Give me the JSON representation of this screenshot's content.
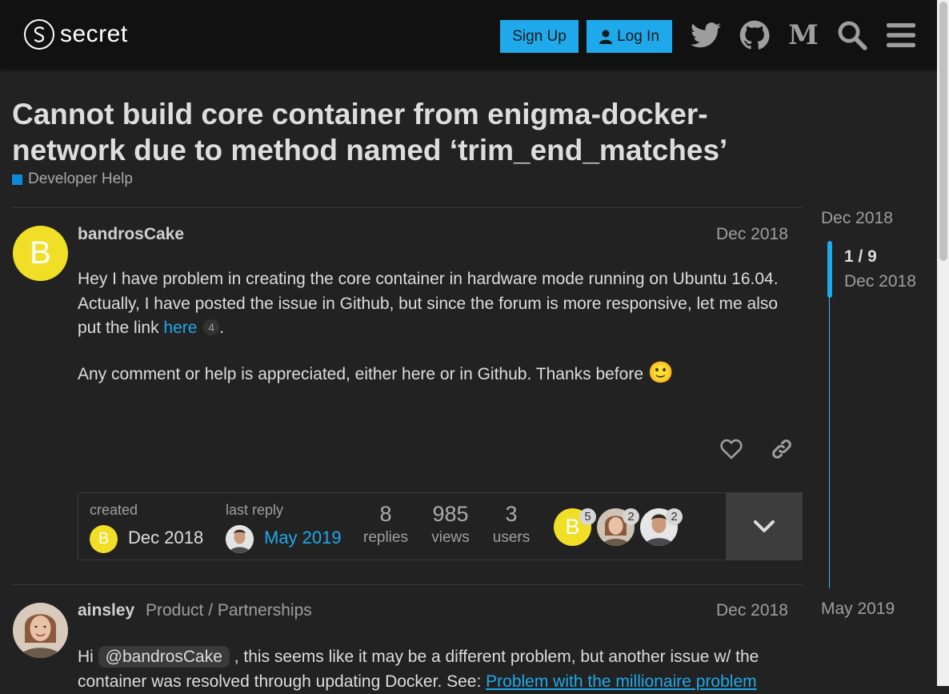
{
  "header": {
    "logo_text": "secret",
    "signup_label": "Sign Up",
    "login_label": "Log In",
    "icons": [
      "twitter-icon",
      "github-icon",
      "medium-icon",
      "search-icon",
      "hamburger-menu-icon"
    ]
  },
  "topic": {
    "title": "Cannot build core container from enigma-docker-network due to method named ‘trim_end_matches’",
    "category": "Developer Help",
    "category_color": "#0b8ad8"
  },
  "post1": {
    "avatar_letter": "B",
    "avatar_color": "#f0de27",
    "username": "bandrosCake",
    "date": "Dec 2018",
    "para1_text": "Hey I have problem in creating the core container in hardware mode running on Ubuntu 16.04. Actually, I have posted the issue in Github, but since the forum is more responsive, let me also put the link ",
    "link_text": "here",
    "link_clicks": "4",
    "para1_end": ".",
    "para2_text": "Any comment or help is appreciated, either here or in Github. Thanks before",
    "emoji": "🙂"
  },
  "topic_map": {
    "created_label": "created",
    "created_date": "Dec 2018",
    "last_reply_label": "last reply",
    "last_reply_date": "May 2019",
    "replies": "8",
    "replies_label": "replies",
    "views": "985",
    "views_label": "views",
    "users": "3",
    "users_label": "users",
    "participants": [
      {
        "letter": "B",
        "count": "5"
      },
      {
        "count": "2"
      },
      {
        "count": "2"
      }
    ]
  },
  "post2": {
    "username": "ainsley",
    "user_title": "Product / Partnerships",
    "date": "Dec 2018",
    "text_hi": "Hi ",
    "mention": "@bandrosCake",
    "text_rest": " , this seems like it may be a different problem, but another issue w/ the",
    "text_line2": "container was resolved through updating Docker. See: ",
    "link_text": "Problem with the millionaire problem"
  },
  "timeline": {
    "start_date": "Dec 2018",
    "position": "1 / 9",
    "position_date": "Dec 2018",
    "end_date": "May 2019"
  }
}
